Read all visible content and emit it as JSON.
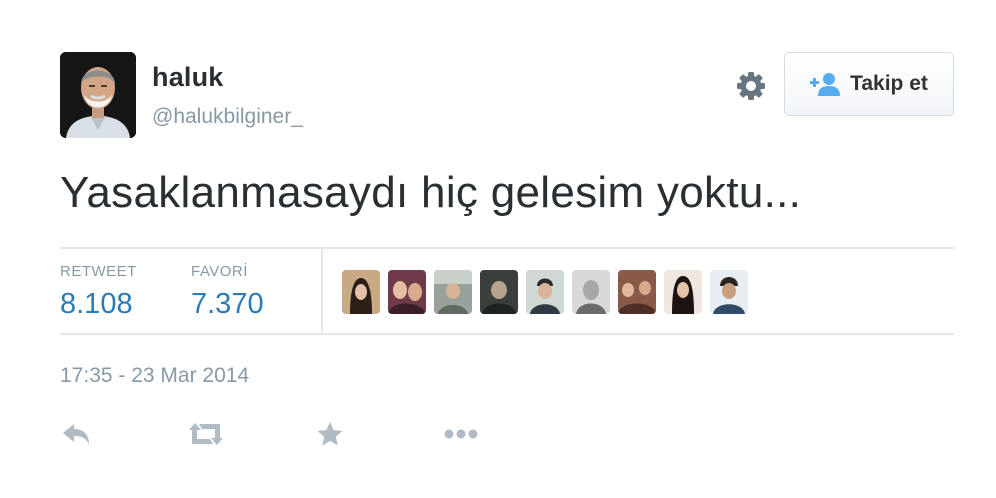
{
  "user": {
    "name": "haluk",
    "handle": "@halukbilginer_"
  },
  "follow_button": {
    "label": "Takip et",
    "icon": "add-user-icon"
  },
  "settings_icon": "gear-icon",
  "tweet": {
    "text": "Yasaklanmasaydı hiç gelesim yoktu..."
  },
  "stats": {
    "retweet_label": "RETWEET",
    "retweet_count": "8.108",
    "favorite_label": "FAVORİ",
    "favorite_count": "7.370"
  },
  "favoriters_count_shown": 9,
  "timestamp": "17:35 - 23 Mar 2014",
  "actions": [
    "reply-icon",
    "retweet-icon",
    "favorite-icon",
    "more-icon"
  ],
  "colors": {
    "accent": "#2b7bb9",
    "muted": "#8899a6",
    "text": "#292f33",
    "divider": "#e1e8ed",
    "action_icon": "#b1bbc3"
  }
}
